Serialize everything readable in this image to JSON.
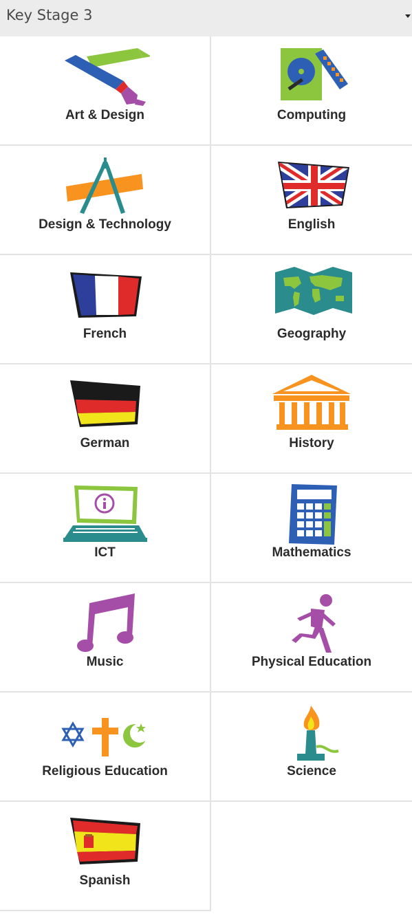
{
  "header": {
    "stage_select_value": "Key Stage 3"
  },
  "subjects": [
    {
      "label": "Art & Design",
      "icon": "art-pencils-icon"
    },
    {
      "label": "Computing",
      "icon": "hard-drive-icon"
    },
    {
      "label": "Design & Technology",
      "icon": "compass-ruler-icon"
    },
    {
      "label": "English",
      "icon": "uk-flag-icon"
    },
    {
      "label": "French",
      "icon": "french-flag-icon"
    },
    {
      "label": "Geography",
      "icon": "world-map-icon"
    },
    {
      "label": "German",
      "icon": "german-flag-icon"
    },
    {
      "label": "History",
      "icon": "museum-icon"
    },
    {
      "label": "ICT",
      "icon": "laptop-icon"
    },
    {
      "label": "Mathematics",
      "icon": "calculator-icon"
    },
    {
      "label": "Music",
      "icon": "music-note-icon"
    },
    {
      "label": "Physical Education",
      "icon": "runner-icon"
    },
    {
      "label": "Religious Education",
      "icon": "religious-symbols-icon"
    },
    {
      "label": "Science",
      "icon": "bunsen-burner-icon"
    },
    {
      "label": "Spanish",
      "icon": "spanish-flag-icon"
    }
  ],
  "colors": {
    "tile_border": "#e3e3e3",
    "header_bg": "#ececec",
    "label_text": "#2b2b2b"
  }
}
